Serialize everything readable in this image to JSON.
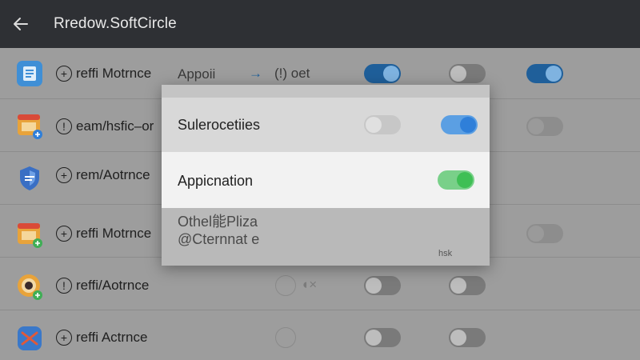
{
  "appbar": {
    "title": "Rredow.SoftCircle",
    "back_icon": "arrow-left-icon"
  },
  "rows": [
    {
      "icon": "doc-app-icon",
      "prefix": "+",
      "label": "reffi Motrnce",
      "extra": "Appoii"
    },
    {
      "icon": "slides-app-icon",
      "prefix": "!",
      "label": "eam/hsfic–or"
    },
    {
      "icon": "shield-app-icon",
      "prefix": "+",
      "label": "rem/Aotrnce"
    },
    {
      "icon": "slides-app-icon",
      "prefix": "+",
      "label": "reffi Motrnce"
    },
    {
      "icon": "eye-app-icon",
      "prefix": "!",
      "label": "reffi/Aotrnce"
    },
    {
      "icon": "shuffle-app-icon",
      "prefix": "+",
      "label": "reffi Actrnce"
    }
  ],
  "row1_col3": "→",
  "row1_col4": "(!) oet",
  "dialog": {
    "item1": "Sulerocetiies",
    "item2": "Appicnation",
    "item3_line1": "Othel能Pliza",
    "item3_line2": "@Cternnat e",
    "footnote": "hsk"
  },
  "colors": {
    "appbar": "#2e3034",
    "toggle_blue": "#2f7fd9",
    "toggle_green": "#3fbf55"
  }
}
